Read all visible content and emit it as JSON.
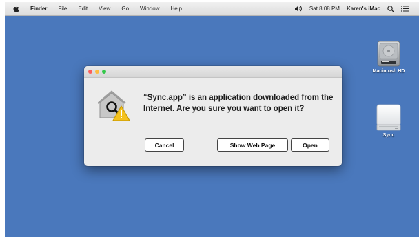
{
  "menubar": {
    "app_name": "Finder",
    "items": [
      "File",
      "Edit",
      "View",
      "Go",
      "Window",
      "Help"
    ],
    "clock": "Sat 8:08 PM",
    "user": "Karen's iMac",
    "icons": [
      "apple-logo",
      "volume-icon",
      "spotlight-search-icon",
      "notification-center-icon"
    ]
  },
  "desktop": {
    "background_color": "#4a78bc",
    "icons": [
      {
        "label": "Macintosh HD",
        "icon": "hard-drive-icon"
      },
      {
        "label": "Sync",
        "icon": "external-drive-icon"
      }
    ]
  },
  "dialog": {
    "message": "“Sync.app” is an application downloaded from the Internet. Are you sure you want to open it?",
    "icon": "gatekeeper-warning-icon",
    "buttons": {
      "cancel": "Cancel",
      "show_web_page": "Show Web Page",
      "open": "Open"
    }
  }
}
